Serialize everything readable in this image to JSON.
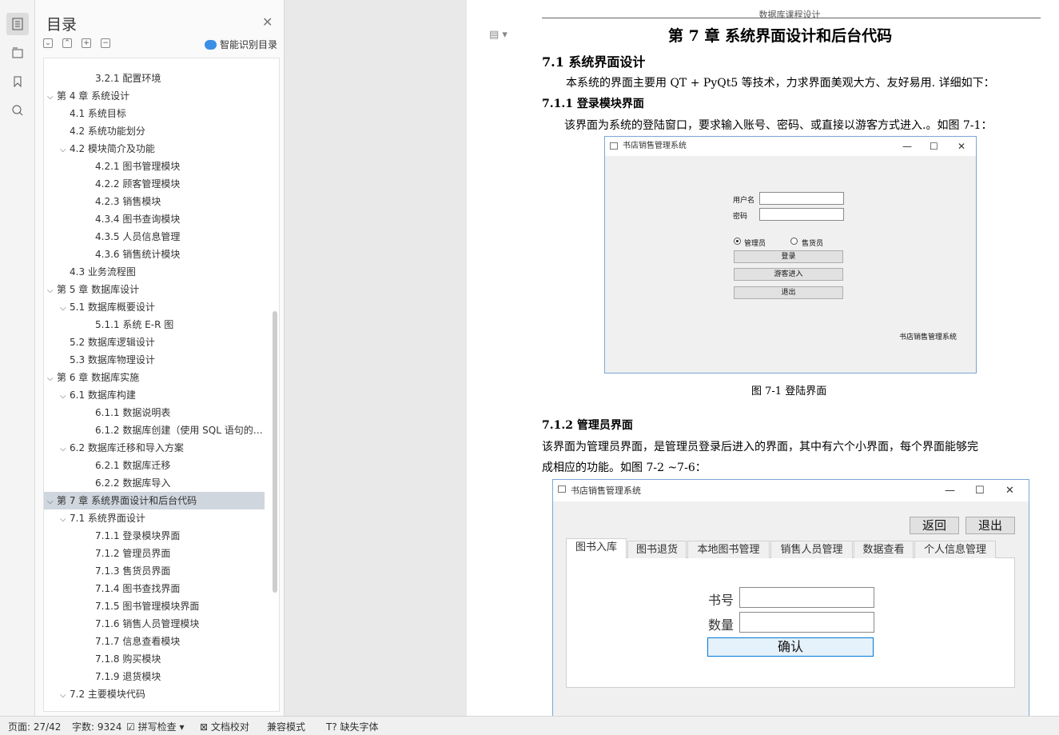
{
  "toc": {
    "title": "目录",
    "smart_label": "智能识别目录",
    "items": [
      {
        "label": "3.2.1  配置环境",
        "level": 3,
        "chevron": ""
      },
      {
        "label": "第 4 章  系统设计",
        "level": 1,
        "chevron": "v"
      },
      {
        "label": "4.1  系统目标",
        "level": 2,
        "chevron": ""
      },
      {
        "label": "4.2  系统功能划分",
        "level": 2,
        "chevron": ""
      },
      {
        "label": "4.2  模块简介及功能",
        "level": 2,
        "chevron": "v"
      },
      {
        "label": "4.2.1  图书管理模块",
        "level": 3,
        "chevron": ""
      },
      {
        "label": "4.2.2  顾客管理模块",
        "level": 3,
        "chevron": ""
      },
      {
        "label": "4.2.3  销售模块",
        "level": 3,
        "chevron": ""
      },
      {
        "label": "4.3.4  图书查询模块",
        "level": 3,
        "chevron": ""
      },
      {
        "label": "4.3.5  人员信息管理",
        "level": 3,
        "chevron": ""
      },
      {
        "label": "4.3.6  销售统计模块",
        "level": 3,
        "chevron": ""
      },
      {
        "label": "4.3  业务流程图",
        "level": 2,
        "chevron": ""
      },
      {
        "label": "第 5 章  数据库设计",
        "level": 1,
        "chevron": "v"
      },
      {
        "label": "5.1  数据库概要设计",
        "level": 2,
        "chevron": "v"
      },
      {
        "label": "5.1.1 系统 E-R 图",
        "level": 3,
        "chevron": ""
      },
      {
        "label": "5.2 数据库逻辑设计",
        "level": 2,
        "chevron": ""
      },
      {
        "label": "5.3  数据库物理设计",
        "level": 2,
        "chevron": ""
      },
      {
        "label": "第 6 章  数据库实施",
        "level": 1,
        "chevron": "v"
      },
      {
        "label": "6.1  数据库构建",
        "level": 2,
        "chevron": "v"
      },
      {
        "label": "6.1.1  数据说明表",
        "level": 3,
        "chevron": ""
      },
      {
        "label": "6.1.2  数据库创建（使用 SQL 语句的 ...",
        "level": 3,
        "chevron": ""
      },
      {
        "label": "6.2  数据库迁移和导入方案",
        "level": 2,
        "chevron": "v"
      },
      {
        "label": "6.2.1 数据库迁移",
        "level": 3,
        "chevron": ""
      },
      {
        "label": "6.2.2 数据库导入",
        "level": 3,
        "chevron": ""
      },
      {
        "label": "第 7 章  系统界面设计和后台代码",
        "level": 1,
        "chevron": "v",
        "selected": true
      },
      {
        "label": "7.1  系统界面设计",
        "level": 2,
        "chevron": "v"
      },
      {
        "label": "7.1.1  登录模块界面",
        "level": 3,
        "chevron": ""
      },
      {
        "label": "7.1.2  管理员界面",
        "level": 3,
        "chevron": ""
      },
      {
        "label": "7.1.3 售货员界面",
        "level": 3,
        "chevron": ""
      },
      {
        "label": "7.1.4 图书查找界面",
        "level": 3,
        "chevron": ""
      },
      {
        "label": "7.1.5  图书管理模块界面",
        "level": 3,
        "chevron": ""
      },
      {
        "label": "7.1.6  销售人员管理模块",
        "level": 3,
        "chevron": ""
      },
      {
        "label": "7.1.7  信息查看模块",
        "level": 3,
        "chevron": ""
      },
      {
        "label": "7.1.8  购买模块",
        "level": 3,
        "chevron": ""
      },
      {
        "label": "7.1.9  退货模块",
        "level": 3,
        "chevron": ""
      },
      {
        "label": "7.2  主要模块代码",
        "level": 2,
        "chevron": "v"
      }
    ]
  },
  "document": {
    "header": "数据库课程设计",
    "chapter_title": "第 7 章  系统界面设计和后台代码",
    "section_71": "7.1  系统界面设计",
    "intro": "本系统的界面主要用 QT + PyQt5 等技术，力求界面美观大方、友好易用. 详细如下：",
    "section_711": "7.1.1  登录模块界面",
    "para_711": "该界面为系统的登陆窗口，要求输入账号、密码、或直接以游客方式进入.。如图 7-1：",
    "caption_71": "图 7-1  登陆界面",
    "section_712": "7.1.2  管理员界面",
    "para_712_line1": "该界面为管理员界面，是管理员登录后进入的界面，其中有六个小界面，每个界面能够完",
    "para_712_line2": "成相应的功能。如图 7-2 ~7-6："
  },
  "login_window": {
    "title": "书店销售管理系统",
    "username_label": "用户名",
    "password_label": "密码",
    "radio_admin": "管理员",
    "radio_seller": "售货员",
    "login_button": "登录",
    "guest_button": "游客进入",
    "exit_button": "退出",
    "footer_text": "书店销售管理系统"
  },
  "admin_window": {
    "title": "书店销售管理系统",
    "back_button": "返回",
    "exit_button": "退出",
    "tabs": [
      "图书入库",
      "图书退货",
      "本地图书管理",
      "销售人员管理",
      "数据查看",
      "个人信息管理"
    ],
    "book_no_label": "书号",
    "quantity_label": "数量",
    "confirm_button": "确认"
  },
  "status_bar": {
    "page": "页面: 27/42",
    "word_count": "字数: 9324",
    "spell_check": "拼写检查",
    "doc_check": "文档校对",
    "compat_mode": "兼容模式",
    "missing_font": "缺失字体"
  }
}
